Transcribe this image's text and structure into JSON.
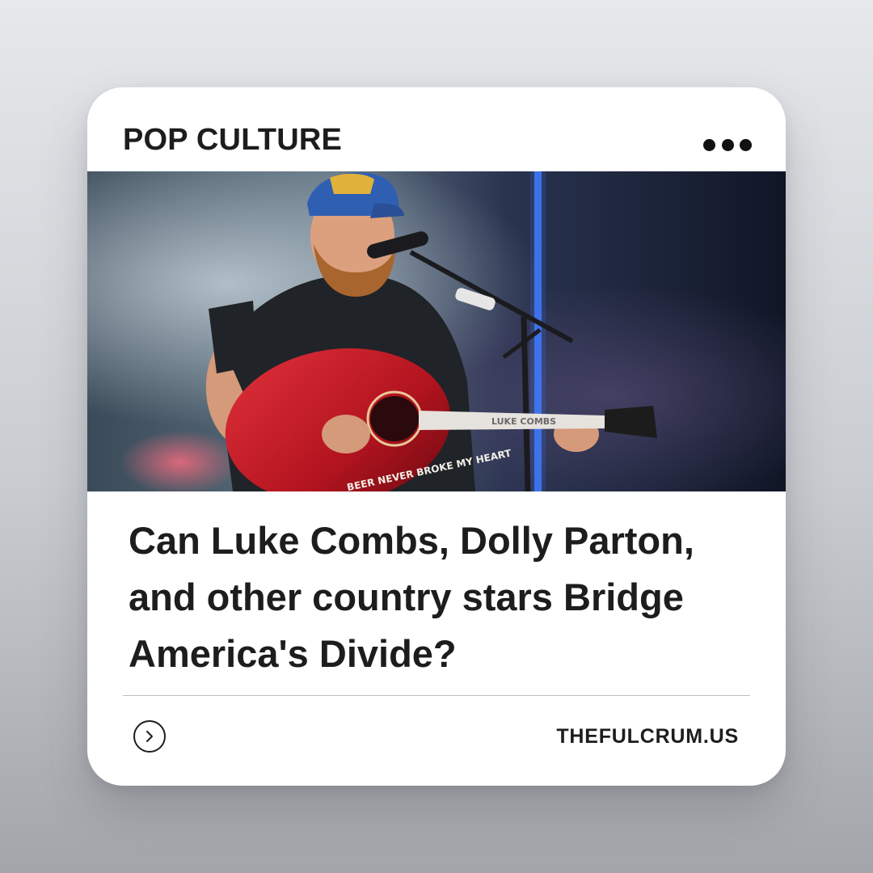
{
  "card": {
    "category": "POP CULTURE",
    "more_icon": "more-horizontal-icon",
    "image": {
      "guitar_body_text": "BEER NEVER BROKE MY HEART",
      "guitar_neck_text": "LUKE COMBS"
    },
    "headline": "Can Luke Combs, Dolly Parton, and other country stars Bridge America's Divide?",
    "go_icon": "chevron-right-circle-icon",
    "source": "THEFULCRUM.US"
  },
  "colors": {
    "card_background": "#ffffff",
    "text": "#1d1d1d",
    "guitar_red": "#c21a24",
    "cap_blue": "#2f5fb3"
  }
}
